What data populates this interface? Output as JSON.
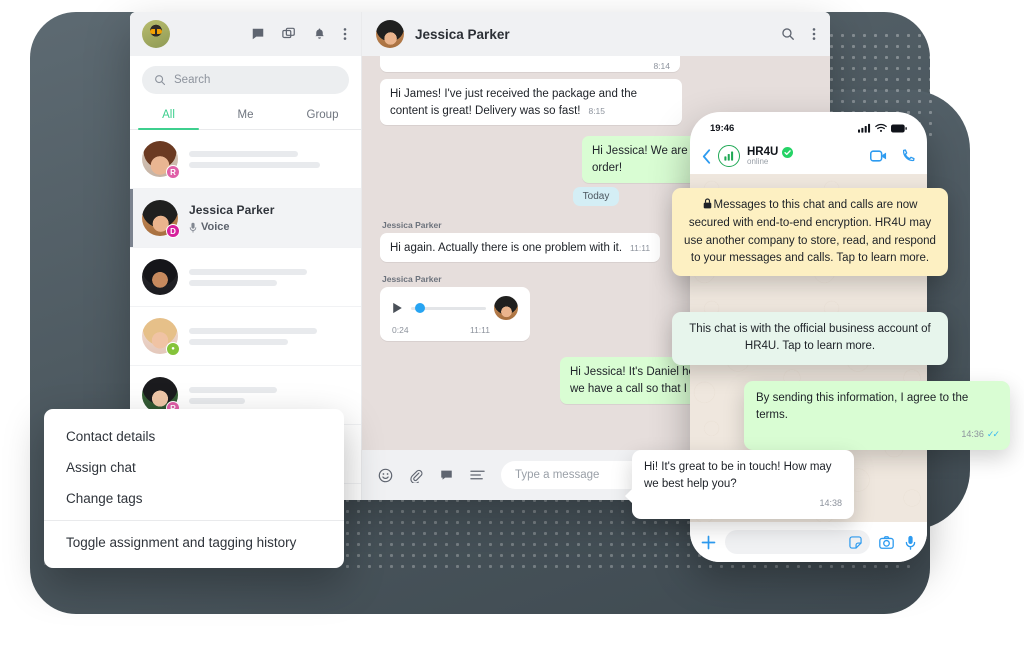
{
  "colors": {
    "accent_green": "#3ecf8e",
    "outgoing_bubble": "#d9fdd3",
    "chat_background": "#e6dedc",
    "encryption_note": "#fdf0c2",
    "business_note": "#e7f5ec",
    "phone_blue": "#2d9bf0",
    "slab": "#4d5960"
  },
  "desktop": {
    "left_panel": {
      "toolbar_icons": [
        "chat-icon",
        "duplicate-icon",
        "bell-icon",
        "more-vertical-icon"
      ],
      "search": {
        "placeholder": "Search",
        "icon": "search-icon",
        "value": ""
      },
      "tabs": [
        {
          "label": "All",
          "active": true
        },
        {
          "label": "Me",
          "active": false
        },
        {
          "label": "Group",
          "active": false
        }
      ],
      "chats": [
        {
          "name": "",
          "subtitle": "",
          "badge": "R",
          "badge_color": "#e05fa8",
          "selected": false,
          "skeleton": true
        },
        {
          "name": "Jessica Parker",
          "subtitle": "Voice",
          "subtitle_icon": "microphone-icon",
          "badge": "D",
          "badge_color": "#d6219c",
          "selected": true,
          "skeleton": false
        },
        {
          "name": "",
          "subtitle": "",
          "badge": "",
          "badge_color": "",
          "selected": false,
          "skeleton": true
        },
        {
          "name": "",
          "subtitle": "",
          "badge": "●",
          "badge_color": "#85c33a",
          "selected": false,
          "skeleton": true
        },
        {
          "name": "",
          "subtitle": "",
          "badge": "R",
          "badge_color": "#e05fa8",
          "selected": false,
          "skeleton": true
        },
        {
          "name": "",
          "subtitle": "",
          "badge": "",
          "badge_color": "",
          "selected": false,
          "skeleton": true
        }
      ]
    },
    "chat_header": {
      "title": "Jessica Parker",
      "icons": [
        "search-icon",
        "more-vertical-icon"
      ]
    },
    "messages": [
      {
        "id": "m0",
        "dir": "in",
        "text": "",
        "time": "8:14",
        "partial": true
      },
      {
        "id": "m1",
        "dir": "in",
        "text": "Hi James! I've just received the package and the content is great! Delivery was so fast!",
        "time": "8:15"
      },
      {
        "id": "m2",
        "dir": "out",
        "text": "Hi Jessica! We are happy to hear that order!",
        "time": ""
      },
      {
        "id": "m3",
        "dir": "in",
        "sender": "Jessica Parker",
        "text": "Hi again. Actually there is one problem with it.",
        "time": "11:11"
      },
      {
        "id": "m4",
        "dir": "out",
        "text": "Hi Jessica! It's Daniel here. The soluti Shall we have a call so that I could gu step?",
        "time": ""
      }
    ],
    "day_divider": "Today",
    "voice_message": {
      "sender": "Jessica Parker",
      "duration": "0:24",
      "time": "11:11",
      "play_icon": "play-icon"
    },
    "composer": {
      "placeholder": "Type a message",
      "value": "",
      "icons": [
        "emoji-icon",
        "attachment-icon",
        "template-icon",
        "notes-icon"
      ]
    }
  },
  "context_menu": {
    "items": [
      {
        "label": "Contact details"
      },
      {
        "label": "Assign chat"
      },
      {
        "label": "Change tags"
      },
      {
        "label": "Toggle assignment and tagging history",
        "after_separator": true
      }
    ]
  },
  "phone": {
    "status_bar": {
      "time": "19:46",
      "icons": [
        "cellular-icon",
        "wifi-icon",
        "battery-icon"
      ]
    },
    "header": {
      "back_icon": "back-chevron-icon",
      "contact_name": "HR4U",
      "verified_icon": "verified-badge-icon",
      "logo_icon": "bar-chart-logo-icon",
      "status": "online",
      "actions": [
        "video-call-icon",
        "voice-call-icon"
      ]
    },
    "bubbles": [
      {
        "id": "encryption",
        "kind": "system-note",
        "icon": "lock-icon",
        "text": "Messages to this chat and calls are now secured with end-to-end encryption. HR4U may use another company to store, read, and respond to your messages and calls. Tap to learn more."
      },
      {
        "id": "business",
        "kind": "system-note",
        "text": "This chat is with the official business account of HR4U. Tap to learn more."
      },
      {
        "id": "terms",
        "kind": "outgoing",
        "text": "By sending this information, I agree to the terms.",
        "time": "14:36",
        "ticks": "✓✓"
      },
      {
        "id": "greeting",
        "kind": "incoming",
        "text": "Hi! It's great to be in touch! How may we best help you?",
        "time": "14:38"
      }
    ],
    "composer": {
      "plus_icon": "plus-icon",
      "value": "",
      "icons": [
        "sticker-icon",
        "camera-icon",
        "microphone-icon"
      ]
    }
  }
}
